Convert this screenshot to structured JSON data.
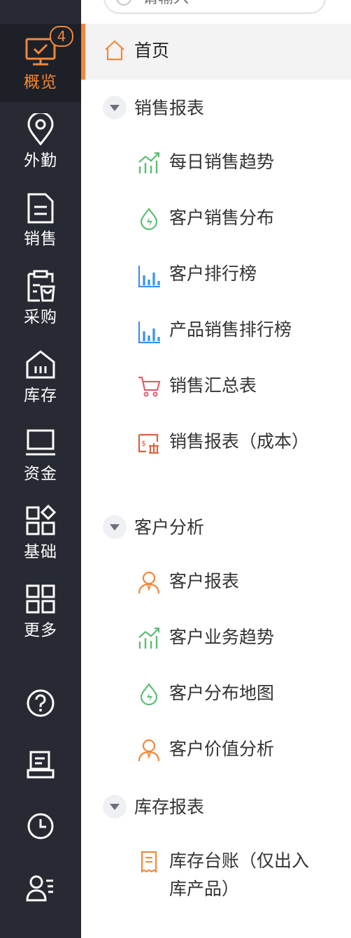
{
  "rail": {
    "badge": "4",
    "items": [
      {
        "label": "概览"
      },
      {
        "label": "外勤"
      },
      {
        "label": "销售"
      },
      {
        "label": "采购"
      },
      {
        "label": "库存"
      },
      {
        "label": "资金"
      },
      {
        "label": "基础"
      },
      {
        "label": "更多"
      }
    ],
    "active_color": "#f0883a",
    "bg_color": "#272a33"
  },
  "search": {
    "placeholder": "请输入"
  },
  "menu": {
    "home": "首页",
    "groups": [
      {
        "title": "销售报表",
        "items": [
          {
            "label": "每日销售趋势",
            "icon": "trend-icon"
          },
          {
            "label": "客户销售分布",
            "icon": "drop-bolt-icon"
          },
          {
            "label": "客户排行榜",
            "icon": "bar-chart-icon"
          },
          {
            "label": "产品销售排行榜",
            "icon": "bar-chart-icon"
          },
          {
            "label": "销售汇总表",
            "icon": "cart-icon"
          },
          {
            "label": "销售报表（成本）",
            "icon": "cost-report-icon"
          }
        ]
      },
      {
        "title": "客户分析",
        "items": [
          {
            "label": "客户报表",
            "icon": "person-icon"
          },
          {
            "label": "客户业务趋势",
            "icon": "trend-icon"
          },
          {
            "label": "客户分布地图",
            "icon": "drop-bolt-icon"
          },
          {
            "label": "客户价值分析",
            "icon": "person-icon"
          }
        ]
      },
      {
        "title": "库存报表",
        "items": [
          {
            "label": "库存台账（仅出入库产品）",
            "icon": "receipt-icon"
          }
        ]
      }
    ]
  }
}
